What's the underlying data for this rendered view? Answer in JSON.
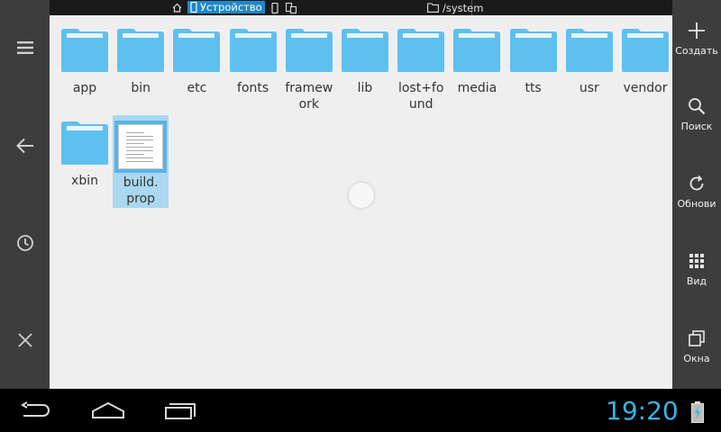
{
  "path_bar": {
    "location_label": "Устройство",
    "path": "/system"
  },
  "left_rail": {
    "items": [
      {
        "name": "menu-icon"
      },
      {
        "name": "back-arrow-icon"
      },
      {
        "name": "history-clock-icon"
      },
      {
        "name": "close-icon"
      }
    ]
  },
  "right_rail": {
    "create_label": "Создать",
    "search_label": "Поиск",
    "refresh_label": "Обнови",
    "view_label": "Вид",
    "windows_label": "Окна"
  },
  "files": [
    {
      "label": "app",
      "type": "folder"
    },
    {
      "label": "bin",
      "type": "folder"
    },
    {
      "label": "etc",
      "type": "folder"
    },
    {
      "label": "fonts",
      "type": "folder"
    },
    {
      "label": "framew\nork",
      "type": "folder"
    },
    {
      "label": "lib",
      "type": "folder"
    },
    {
      "label": "lost+fo\nund",
      "type": "folder"
    },
    {
      "label": "media",
      "type": "folder"
    },
    {
      "label": "tts",
      "type": "folder"
    },
    {
      "label": "usr",
      "type": "folder"
    },
    {
      "label": "vendor",
      "type": "folder"
    },
    {
      "label": "xbin",
      "type": "folder"
    },
    {
      "label": "build.\nprop",
      "type": "file",
      "selected": true
    }
  ],
  "status": {
    "time": "19:20"
  },
  "colors": {
    "accent": "#33b5e5",
    "folder": "#5ec0ef",
    "selection": "#a9d8f0"
  }
}
